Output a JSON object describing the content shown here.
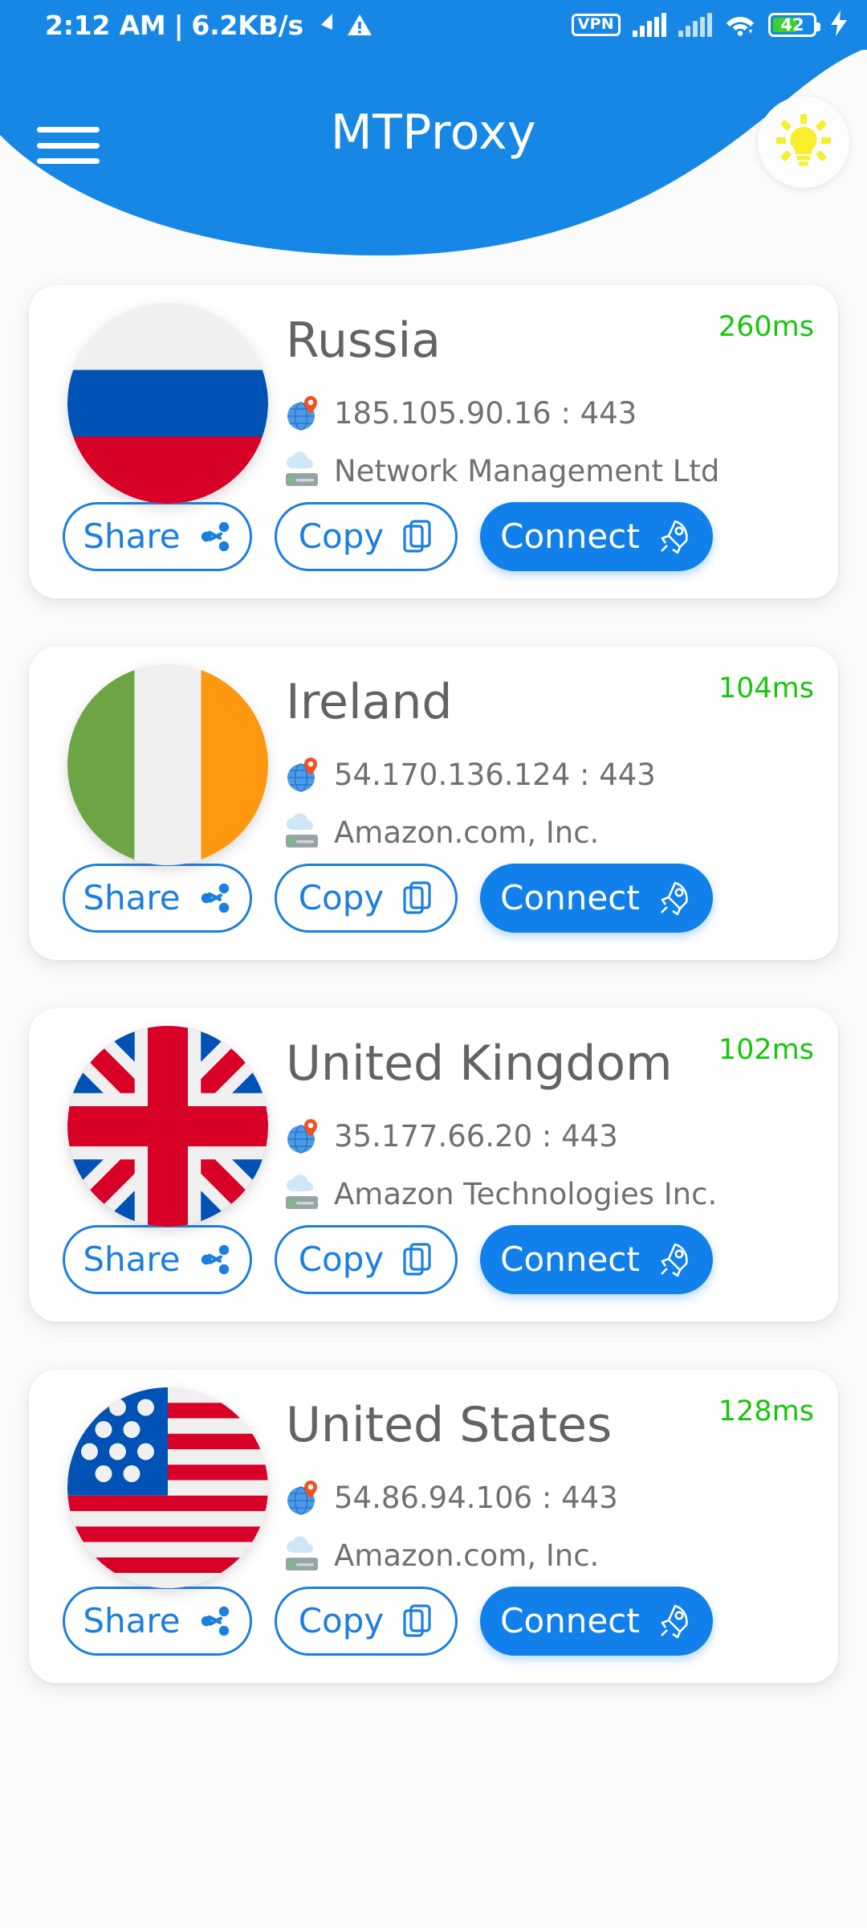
{
  "status_bar": {
    "clock": "2:12 AM",
    "separator": "|",
    "net_speed": "6.2KB/s",
    "download_arrow_icon": "download-arrow-icon",
    "warning_icon": "warning-triangle-icon",
    "vpn_label": "VPN",
    "signal_icon_1": "signal-bars-icon",
    "signal_icon_2": "signal-bars-icon",
    "wifi_icon": "wifi-icon",
    "battery_level": "42",
    "charging_icon": "charging-bolt-icon"
  },
  "header": {
    "menu_icon": "hamburger-menu-icon",
    "title": "MTProxy",
    "theme_toggle_icon": "lightbulb-icon",
    "background_color": "#1787E5"
  },
  "colors": {
    "accent": "#1180EA",
    "header_blue": "#1787E5",
    "ping_green": "#16C60C",
    "card_white": "#FFFFFF",
    "page_background": "#FBFBFB",
    "text_gray": "#707070"
  },
  "buttons": {
    "share_label": "Share",
    "copy_label": "Copy",
    "connect_label": "Connect",
    "share_icon": "share-icon",
    "copy_icon": "copy-icon",
    "connect_icon": "rocket-icon"
  },
  "row_icons": {
    "ip_icon": "globe-location-pin-icon",
    "isp_icon": "cloud-server-icon"
  },
  "proxies": [
    {
      "country": "Russia",
      "flag": "flag-russia-icon",
      "ping": "260ms",
      "ip": "185.105.90.16 : 443",
      "isp": "Network Management Ltd"
    },
    {
      "country": "Ireland",
      "flag": "flag-ireland-icon",
      "ping": "104ms",
      "ip": "54.170.136.124 : 443",
      "isp": "Amazon.com, Inc."
    },
    {
      "country": "United Kingdom",
      "flag": "flag-united-kingdom-icon",
      "ping": "102ms",
      "ip": "35.177.66.20 : 443",
      "isp": "Amazon Technologies Inc."
    },
    {
      "country": "United States",
      "flag": "flag-united-states-icon",
      "ping": "128ms",
      "ip": "54.86.94.106 : 443",
      "isp": "Amazon.com, Inc."
    }
  ]
}
